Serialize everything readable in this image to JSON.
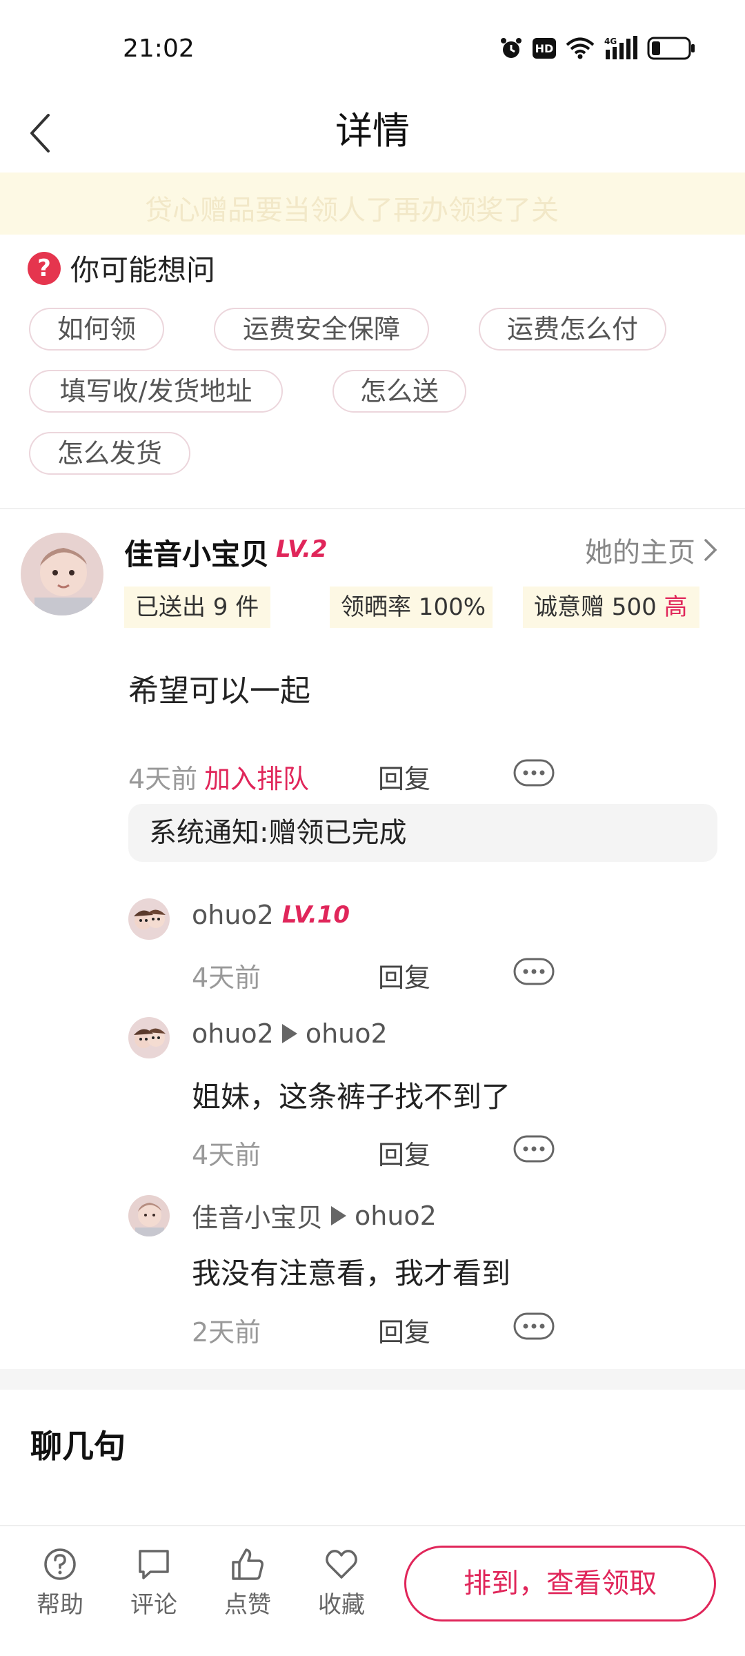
{
  "status_bar": {
    "time": "21:02",
    "network": "4G",
    "hd": "HD"
  },
  "header": {
    "title": "详情"
  },
  "notice": {
    "text": "贷心赠品要当领人了再办领奖了关"
  },
  "faq": {
    "title": "你可能想问",
    "chips": [
      "如何领",
      "运费安全保障",
      "运费怎么付",
      "填写收/发货地址",
      "怎么送",
      "怎么发货"
    ]
  },
  "post": {
    "username": "佳音小宝贝",
    "level": "LV.2",
    "home_link": "她的主页",
    "stats": {
      "sent": "已送出 9 件",
      "rate": "领晒率 100%",
      "sincerity": "诚意赠 500",
      "sincerity_level": "高"
    },
    "body": "希望可以一起",
    "time": "4天前",
    "join_label": "加入排队",
    "reply_label": "回复",
    "system_note": "系统通知:赠领已完成"
  },
  "replies": [
    {
      "user": "ohuo2",
      "level": "LV.10",
      "time": "4天前",
      "reply_label": "回复"
    },
    {
      "user": "ohuo2",
      "to": "ohuo2",
      "body": "姐妹，这条裤子找不到了",
      "time": "4天前",
      "reply_label": "回复"
    },
    {
      "user": "佳音小宝贝",
      "to": "ohuo2",
      "body": "我没有注意看，我才看到",
      "time": "2天前",
      "reply_label": "回复"
    }
  ],
  "chat_section": {
    "title": "聊几句"
  },
  "bottom_bar": {
    "help": "帮助",
    "comment": "评论",
    "like": "点赞",
    "favorite": "收藏",
    "claim_button": "排到，查看领取"
  },
  "colors": {
    "accent": "#e0265a",
    "notice_bg": "#fdf9e4",
    "stat_bg": "#fdf8e4"
  }
}
